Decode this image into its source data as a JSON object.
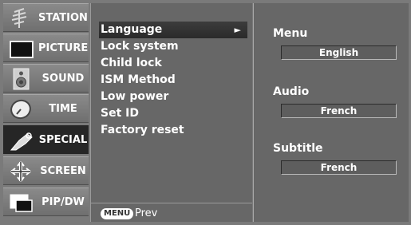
{
  "categories": [
    {
      "label": "STATION",
      "icon": "station-icon"
    },
    {
      "label": "PICTURE",
      "icon": "picture-icon"
    },
    {
      "label": "SOUND",
      "icon": "sound-icon"
    },
    {
      "label": "TIME",
      "icon": "time-icon"
    },
    {
      "label": "SPECIAL",
      "icon": "special-icon",
      "selected": true
    },
    {
      "label": "SCREEN",
      "icon": "screen-icon"
    },
    {
      "label": "PIP/DW",
      "icon": "pip-icon"
    }
  ],
  "menu": {
    "items": [
      {
        "label": "Language",
        "highlighted": true,
        "arrow": "►"
      },
      {
        "label": "Lock system"
      },
      {
        "label": "Child lock"
      },
      {
        "label": "ISM Method"
      },
      {
        "label": "Low power"
      },
      {
        "label": "Set ID"
      },
      {
        "label": "Factory reset"
      }
    ],
    "footer": {
      "key_label": "MENU",
      "action_label": "Prev"
    }
  },
  "options": [
    {
      "label": "Menu",
      "value": "English"
    },
    {
      "label": "Audio",
      "value": "French"
    },
    {
      "label": "Subtitle",
      "value": "French"
    }
  ]
}
